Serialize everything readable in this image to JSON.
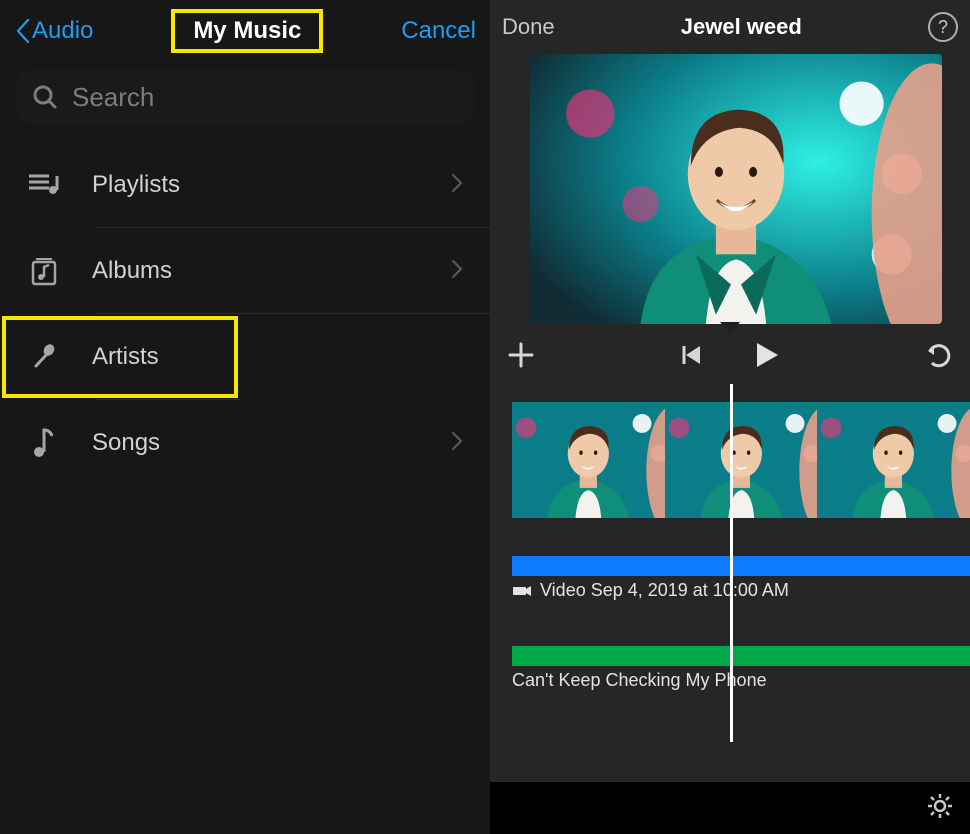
{
  "left": {
    "back_label": "Audio",
    "title": "My Music",
    "cancel_label": "Cancel",
    "search_placeholder": "Search",
    "categories": [
      {
        "key": "playlists",
        "label": "Playlists",
        "highlighted": false
      },
      {
        "key": "albums",
        "label": "Albums",
        "highlighted": false
      },
      {
        "key": "artists",
        "label": "Artists",
        "highlighted": true
      },
      {
        "key": "songs",
        "label": "Songs",
        "highlighted": false
      }
    ]
  },
  "right": {
    "done_label": "Done",
    "title": "Jewel weed",
    "help_glyph": "?",
    "timeline": {
      "video_clip_label": "Video Sep 4, 2019 at 10:00 AM",
      "audio_clip_label": "Can't Keep Checking My Phone"
    }
  },
  "highlight_color": "#f7e600"
}
